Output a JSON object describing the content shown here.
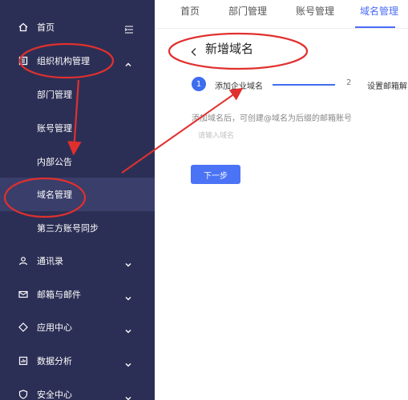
{
  "sidebar": {
    "home_label": "首页",
    "org_label": "组织机构管理",
    "sub_items": [
      {
        "label": "部门管理"
      },
      {
        "label": "账号管理"
      },
      {
        "label": "内部公告"
      },
      {
        "label": "域名管理"
      },
      {
        "label": "第三方账号同步"
      }
    ],
    "groups": [
      {
        "label": "通讯录"
      },
      {
        "label": "邮箱与邮件"
      },
      {
        "label": "应用中心"
      },
      {
        "label": "数据分析"
      },
      {
        "label": "安全中心"
      }
    ]
  },
  "tabs": [
    {
      "label": "首页"
    },
    {
      "label": "部门管理"
    },
    {
      "label": "账号管理"
    },
    {
      "label": "域名管理"
    }
  ],
  "page": {
    "title": "新增域名",
    "step1_num": "1",
    "step1_label": "添加企业域名",
    "step2_num": "2",
    "step2_label": "设置邮箱解",
    "hint": "添加域名后，可创建@域名为后缀的邮箱账号",
    "input_placeholder": "请输入域名",
    "next_label": "下一步"
  },
  "colors": {
    "sidebar_bg": "#2c2f55",
    "accent": "#4a6cf7",
    "annotation": "#e0302e"
  }
}
